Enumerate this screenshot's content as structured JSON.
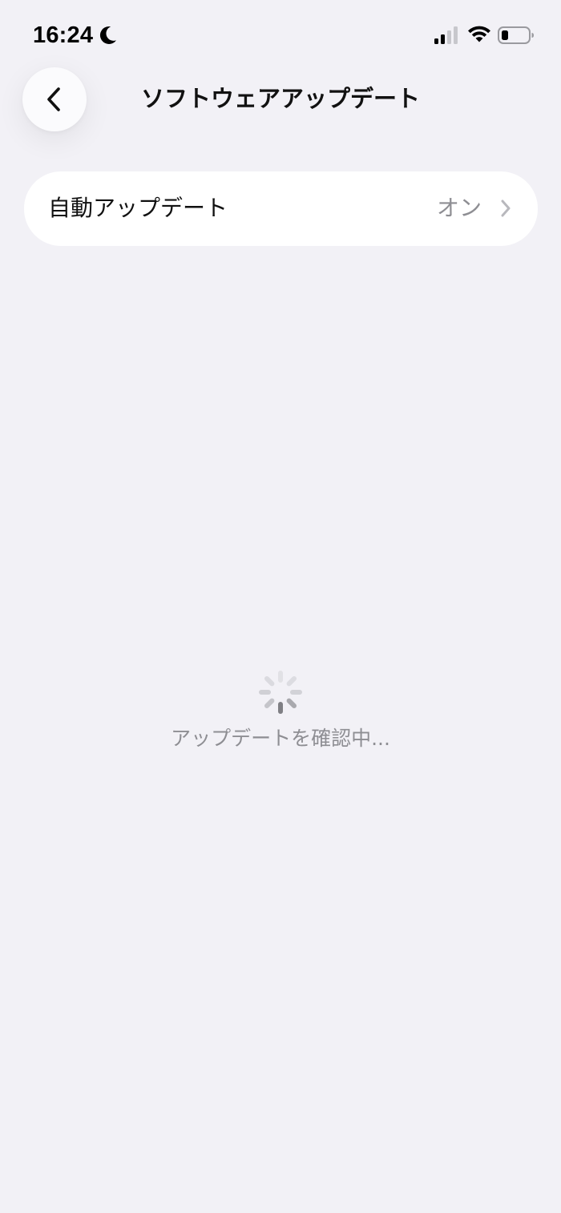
{
  "status_bar": {
    "time": "16:24",
    "icons": [
      "moon-icon",
      "signal-icon",
      "wifi-icon",
      "battery-icon"
    ]
  },
  "header": {
    "title": "ソフトウェアアップデート",
    "back_icon": "chevron-left-icon"
  },
  "settings": {
    "auto_update": {
      "label": "自動アップデート",
      "value": "オン",
      "icon": "chevron-right-icon"
    }
  },
  "loading": {
    "text": "アップデートを確認中...",
    "icon": "spinner-icon"
  },
  "colors": {
    "background": "#f2f1f6",
    "card": "#ffffff",
    "secondary_text": "#8e8e93"
  }
}
